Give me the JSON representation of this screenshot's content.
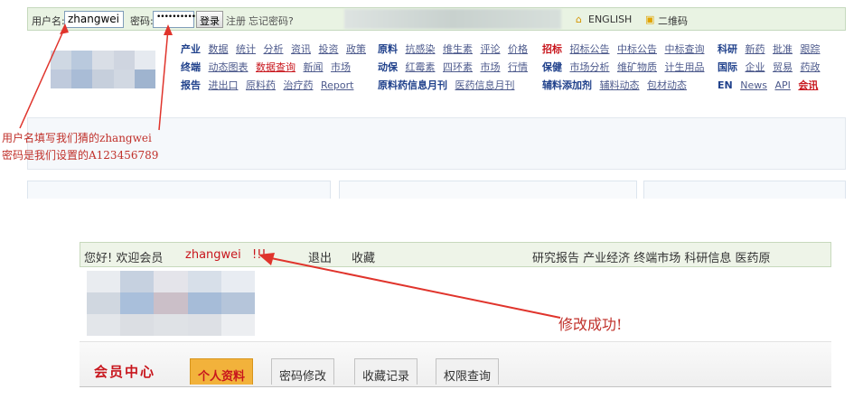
{
  "top_section": {
    "login_bar": {
      "username_label": "用户名:",
      "username_value": "zhangwei",
      "password_label": "密码:",
      "password_value": "••••••••••",
      "login_button": "登录",
      "register_link": "注册",
      "forgot_link": "忘记密码?",
      "english_link": "ENGLISH",
      "qrcode_link": "二维码"
    },
    "nav_columns": [
      {
        "rows": [
          {
            "key": "产业",
            "links": [
              "数据",
              "统计",
              "分析",
              "资讯",
              "投资",
              "政策"
            ]
          },
          {
            "key": "终端",
            "links": [
              "动态图表",
              "数据查询",
              "新闻",
              "市场"
            ]
          },
          {
            "key": "报告",
            "links": [
              "进出口",
              "原料药",
              "治疗药",
              "Report"
            ]
          }
        ]
      },
      {
        "rows": [
          {
            "key": "原料",
            "links": [
              "抗感染",
              "维生素",
              "评论",
              "价格"
            ]
          },
          {
            "key": "动保",
            "links": [
              "红霉素",
              "四环素",
              "市场",
              "行情"
            ]
          },
          {
            "key": "原料药信息月刊",
            "links": [
              "医药信息月刊"
            ]
          }
        ]
      },
      {
        "rows": [
          {
            "key": "招标",
            "links": [
              "招标公告",
              "中标公告",
              "中标查询"
            ]
          },
          {
            "key": "保健",
            "links": [
              "市场分析",
              "维矿物质",
              "计生用品"
            ]
          },
          {
            "key": "辅料添加剂",
            "links": [
              "辅料动态",
              "包材动态"
            ]
          }
        ]
      },
      {
        "rows": [
          {
            "key": "科研",
            "links": [
              "新药",
              "批准",
              "跟踪"
            ]
          },
          {
            "key": "国际",
            "links": [
              "企业",
              "贸易",
              "药政"
            ]
          },
          {
            "key": "EN",
            "links": [
              "News",
              "API",
              "会讯"
            ]
          }
        ]
      }
    ],
    "annotation_line1": "用户名填写我们猜的zhangwei",
    "annotation_line2": "密码是我们设置的A123456789"
  },
  "bottom_section": {
    "welcome_prefix": "您好! 欢迎会员",
    "welcome_user": "zhangwei",
    "welcome_suffix": "!!!",
    "logout_link": "退出",
    "favorite_link": "收藏",
    "right_nav": "研究报告  产业经济  终端市场  科研信息  医药原",
    "success_annotation": "修改成功!",
    "member_center": "会员中心",
    "tabs": [
      "个人资料",
      "密码修改",
      "收藏记录",
      "权限查询"
    ]
  },
  "colors": {
    "annotation_red": "#e0342c",
    "nav_blue": "#21428c",
    "highlight_red": "#c8161d",
    "tab_active": "#f2b23b"
  }
}
